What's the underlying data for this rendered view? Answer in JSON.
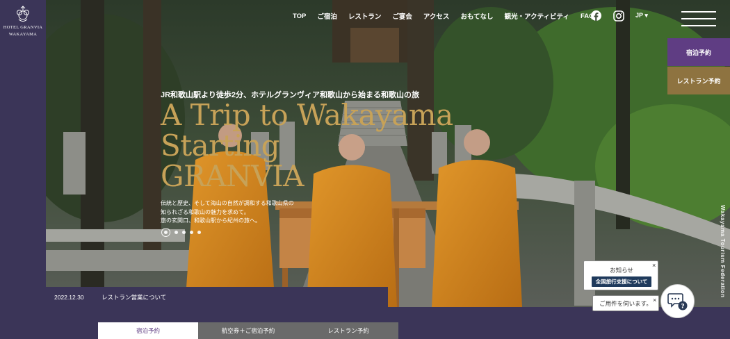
{
  "brand": {
    "line1": "HOTEL GRANVIA",
    "line2": "WAKAYAMA"
  },
  "nav": [
    "TOP",
    "ご宿泊",
    "レストラン",
    "ご宴会",
    "アクセス",
    "おもてなし",
    "観光・アクティビティ",
    "FAQ"
  ],
  "lang": "JP ▾",
  "side_buttons": {
    "stay": "宿泊予約",
    "restaurant": "レストラン予約"
  },
  "hero": {
    "tagline": "JR和歌山駅より徒歩2分、ホテルグランヴィア和歌山から始まる和歌山の旅",
    "title_lines": [
      "A Trip to Wakayama",
      "Starting",
      "GRANVIA"
    ],
    "desc_lines": [
      "伝統と歴史、そして海山の自然が調和する和歌山県の",
      "知られざる和歌山の魅力を求めて。",
      "旅の玄関口、和歌山駅から紀州の旅へ。"
    ],
    "slides": 5,
    "active_slide": 1,
    "credit": "Wakayama Tourism Federation"
  },
  "news": {
    "date": "2022.12.30",
    "text": "レストラン営業について"
  },
  "notice": {
    "title": "お知らせ",
    "badge": "全国旅行支援について",
    "close": "×"
  },
  "chat": {
    "prompt": "ご用件を伺います。",
    "close": "×"
  },
  "tabs": [
    "宿泊予約",
    "航空券＋ご宿泊予約",
    "レストラン予約"
  ],
  "colors": {
    "sidebar": "#3b3558",
    "title_gold": "#c7a258",
    "stay_purple": "#5f3d83",
    "rest_gold": "#8e7340",
    "badge_navy": "#1f3a5c"
  }
}
